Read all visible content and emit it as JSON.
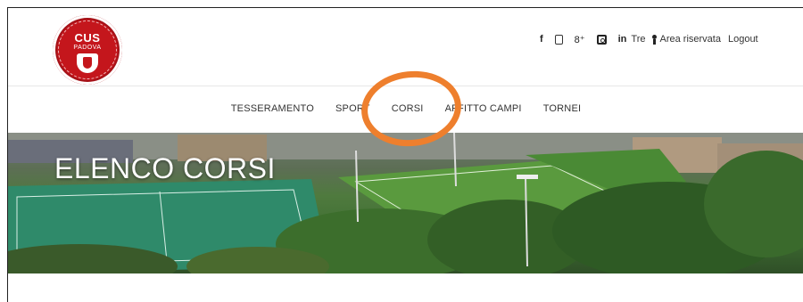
{
  "logo": {
    "title": "CUS",
    "subtitle": "PADOVA"
  },
  "social": {
    "facebook": "f",
    "googleplus": "8⁺",
    "linkedin": "in",
    "extra_text": "Tre"
  },
  "header_links": {
    "reserved_area": "Area riservata",
    "logout": "Logout"
  },
  "nav": {
    "items": [
      {
        "label": "TESSERAMENTO"
      },
      {
        "label": "SPORT"
      },
      {
        "label": "CORSI"
      },
      {
        "label": "AFFITTO CAMPI"
      },
      {
        "label": "TORNEI"
      }
    ]
  },
  "hero": {
    "title": "ELENCO CORSI"
  },
  "colors": {
    "highlight_circle": "#ee7f2d",
    "logo_red": "#c4161c"
  }
}
